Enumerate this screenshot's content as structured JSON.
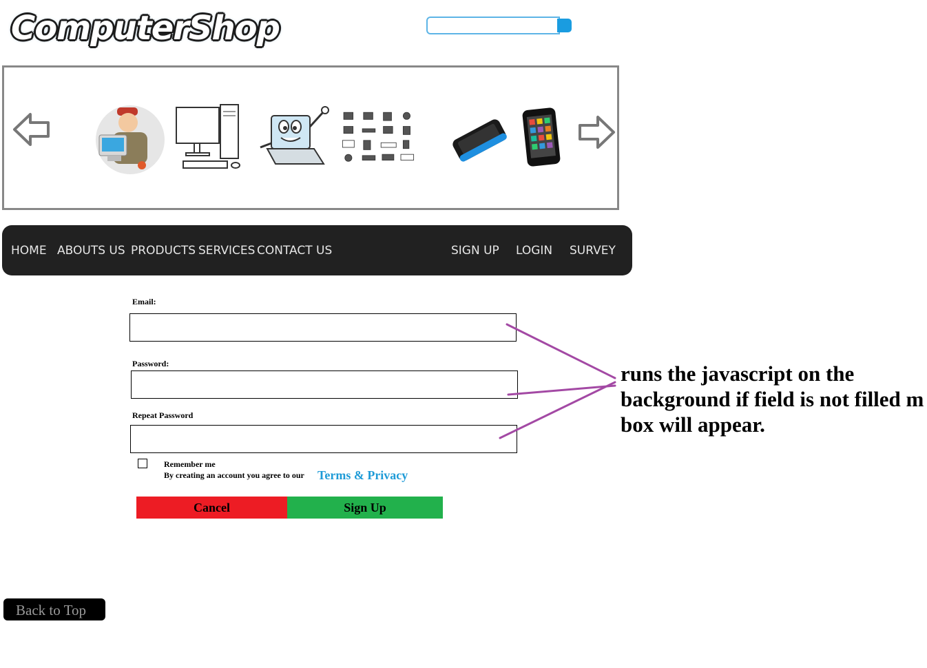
{
  "header": {
    "logo_text": "ComputerShop",
    "search": {
      "placeholder": "",
      "value": ""
    }
  },
  "carousel": {
    "items": [
      "technician-icon",
      "desktop-computer-icon",
      "laptop-mascot-icon",
      "hardware-grid-icon",
      "smartphone-icon",
      "tablet-icon"
    ]
  },
  "nav": {
    "left": [
      {
        "label": "HOME"
      },
      {
        "label": "ABOUTS US"
      },
      {
        "label": "PRODUCTS"
      },
      {
        "label": "SERVICES"
      },
      {
        "label": "CONTACT US"
      }
    ],
    "right": [
      {
        "label": "SIGN UP"
      },
      {
        "label": "LOGIN"
      },
      {
        "label": "SURVEY"
      }
    ]
  },
  "form": {
    "email_label": "Email:",
    "password_label": "Password:",
    "repeat_password_label": "Repeat Password",
    "remember_label": "Remember me",
    "agree_text": "By creating an account you agree to our",
    "terms_link": "Terms & Privacy",
    "cancel_label": "Cancel",
    "signup_label": "Sign Up"
  },
  "annotation": {
    "lines": [
      "runs the javascript on the",
      "background if field is not filled m",
      "box will appear."
    ],
    "arrow_color": "#a349a4"
  },
  "footer": {
    "back_to_top": "Back to Top"
  },
  "colors": {
    "nav_bg": "#212121",
    "cancel": "#ed1c24",
    "signup": "#22b14c",
    "link": "#1e9bd7",
    "search_accent": "#1a9ce0"
  }
}
